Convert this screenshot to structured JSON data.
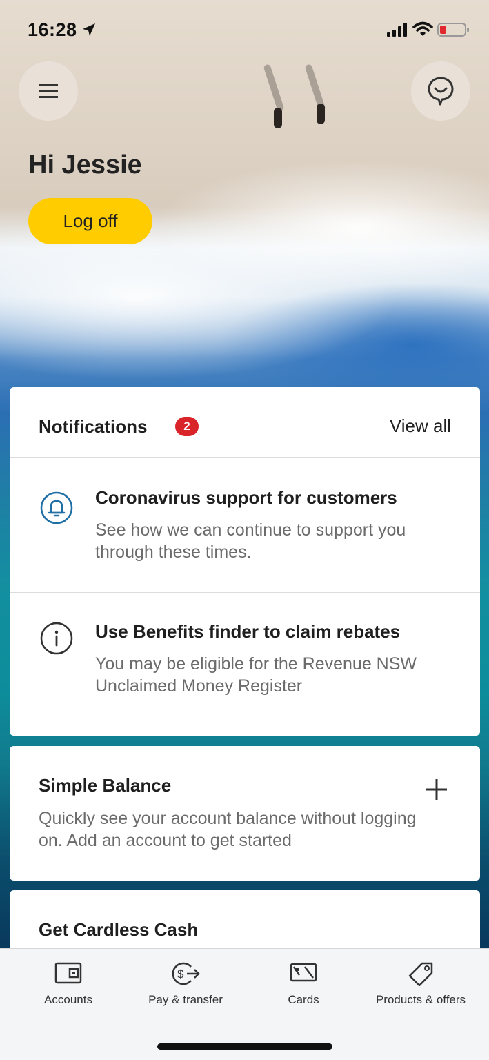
{
  "status_bar": {
    "time": "16:28",
    "icons": [
      "location-arrow-icon",
      "signal-icon",
      "wifi-icon",
      "battery-low-icon"
    ]
  },
  "header": {
    "menu_icon": "hamburger-menu-icon",
    "chat_icon": "chat-bubble-icon",
    "greeting": "Hi Jessie",
    "logoff_label": "Log off"
  },
  "notifications": {
    "title": "Notifications",
    "badge_count": "2",
    "view_all_label": "View all",
    "items": [
      {
        "icon": "bell-icon",
        "title": "Coronavirus support for customers",
        "body": "See how we can continue to support you through these times."
      },
      {
        "icon": "info-icon",
        "title": "Use Benefits finder to claim rebates",
        "body": "You may be eligible for the Revenue NSW Unclaimed Money Register"
      }
    ]
  },
  "simple_balance": {
    "title": "Simple Balance",
    "body": "Quickly see your account balance without logging on. Add an account to get started",
    "add_icon": "plus-icon"
  },
  "cardless_cash": {
    "title": "Get Cardless Cash"
  },
  "tab_bar": {
    "tabs": [
      {
        "label": "Accounts",
        "icon": "wallet-icon"
      },
      {
        "label": "Pay & transfer",
        "icon": "dollar-transfer-icon"
      },
      {
        "label": "Cards",
        "icon": "card-icon"
      },
      {
        "label": "Products & offers",
        "icon": "tag-icon"
      }
    ]
  },
  "colors": {
    "accent_yellow": "#ffcc00",
    "badge_red": "#d9242a",
    "bell_blue": "#1f6fa6"
  }
}
